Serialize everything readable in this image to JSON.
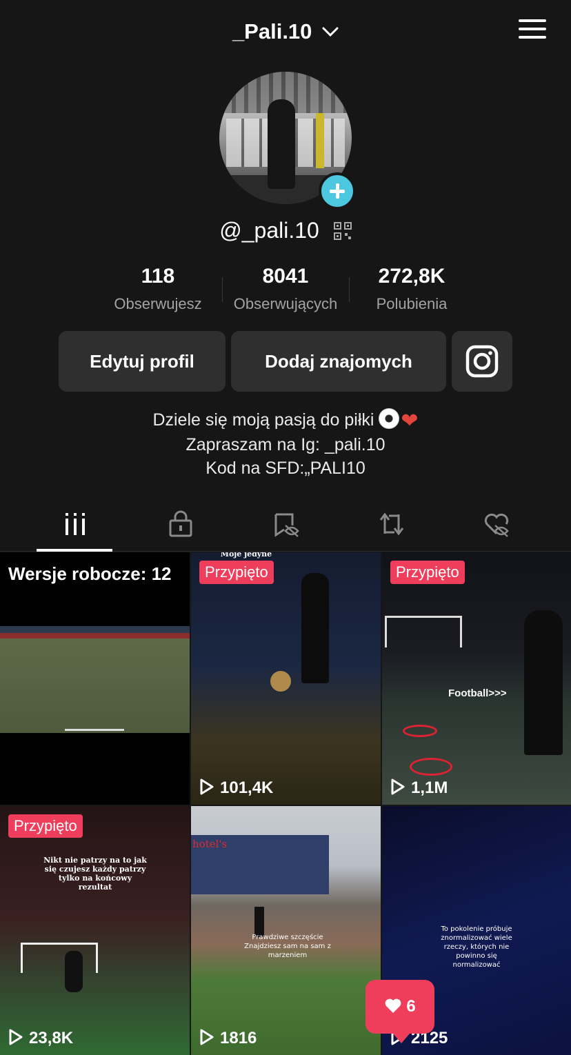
{
  "header": {
    "username_title": "_Pali.10"
  },
  "profile": {
    "handle": "@_pali.10"
  },
  "stats": [
    {
      "value": "118",
      "label": "Obserwujesz"
    },
    {
      "value": "8041",
      "label": "Obserwujących"
    },
    {
      "value": "272,8K",
      "label": "Polubienia"
    }
  ],
  "buttons": {
    "edit_profile": "Edytuj profil",
    "add_friends": "Dodaj znajomych"
  },
  "bio": {
    "line1": "Dziele się moją pasją do piłki",
    "line2": "Zapraszam na Ig: _pali.10",
    "line3": "Kod na SFD:„PALI10"
  },
  "tabs": [
    "videos-grid",
    "private",
    "favorites",
    "reposts",
    "liked"
  ],
  "videos": [
    {
      "drafts_label": "Wersje robocze: 12"
    },
    {
      "pinned": "Przypięto",
      "views": "101,4K",
      "overlay": "Moje jedyne"
    },
    {
      "pinned": "Przypięto",
      "views": "1,1M",
      "overlay": "Football>>>"
    },
    {
      "pinned": "Przypięto",
      "views": "23,8K",
      "overlay": "Nikt nie patrzy na to jak się czujesz każdy patrzy tylko na końcowy rezultat"
    },
    {
      "views": "1816",
      "overlay": "Prawdziwe szczęście Znajdziesz sam na sam z marzeniem",
      "sign": "hotel's"
    },
    {
      "views": "2125",
      "overlay": "To pokolenie próbuje znormalizować wiele rzeczy, których nie powinno się normalizować"
    }
  ],
  "like_notification": {
    "count": "6"
  },
  "colors": {
    "accent_pink": "#ef3e5c",
    "avatar_plus": "#4dc6e0",
    "background": "#161616"
  }
}
